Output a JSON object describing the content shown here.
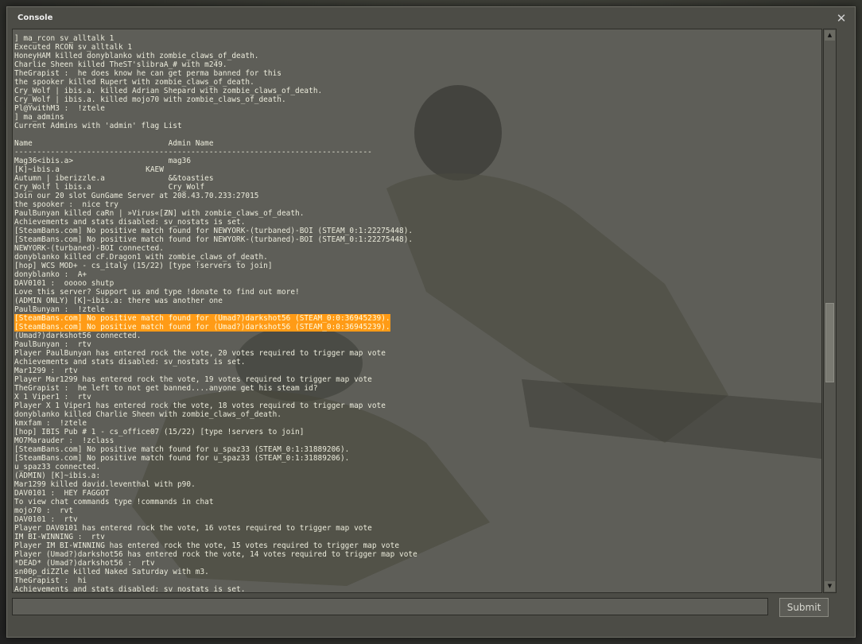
{
  "window": {
    "title": "Console",
    "close_label": "✕"
  },
  "console": {
    "lines": [
      {
        "text": "] ma_rcon sv_alltalk 1"
      },
      {
        "text": "Executed RCON sv_alltalk 1"
      },
      {
        "text": "HoneyHAM killed donyblanko with zombie_claws_of_death."
      },
      {
        "text": "Charlie Sheen killed TheST'slibraA_# with m249."
      },
      {
        "text": "TheGrapist :  he does know he can get perma banned for this"
      },
      {
        "text": "the spooker killed Rupert with zombie_claws_of_death."
      },
      {
        "text": "Cry_Wolf | ibis.a. killed Adrian Shepard with zombie_claws_of_death."
      },
      {
        "text": "Cry_Wolf | ibis.a. killed mojo70 with zombie_claws_of_death."
      },
      {
        "text": "Pl@YwithM3 :  !ztele"
      },
      {
        "text": "] ma_admins"
      },
      {
        "text": "Current Admins with 'admin' flag List"
      },
      {
        "text": ""
      },
      {
        "text": "Name                              Admin Name"
      },
      {
        "text": "-------------------------------------------------------------------------------"
      },
      {
        "text": "Mag36<ibis.a>                     mag36"
      },
      {
        "text": "[K]~ibis.a                   KAEW"
      },
      {
        "text": "Autumn | iberizzle.a              &&toasties"
      },
      {
        "text": "Cry_Wolf l ibis.a                 Cry_Wolf"
      },
      {
        "text": "Join our 20 slot GunGame Server at 208.43.70.233:27015"
      },
      {
        "text": "the spooker :  nice try"
      },
      {
        "text": "PaulBunyan killed caRn | »Virus«[ƵN] with zombie_claws_of_death."
      },
      {
        "text": "Achievements and stats disabled: sv_nostats is set."
      },
      {
        "text": "[SteamBans.com] No positive match found for NEWYORK-(turbaned)-BOI (STEAM_0:1:22275448)."
      },
      {
        "text": "[SteamBans.com] No positive match found for NEWYORK-(turbaned)-BOI (STEAM_0:1:22275448)."
      },
      {
        "text": "NEWYORK-(turbaned)-BOI connected."
      },
      {
        "text": "donyblanko killed cF.Dragon1 with zombie_claws_of_death."
      },
      {
        "text": "[hop] WCS MOD+ - cs_italy (15/22) [type !servers to join]"
      },
      {
        "text": "donyblanko :  A+"
      },
      {
        "text": "DAV0101 :  ooooo shutp"
      },
      {
        "text": "Love this server? Support us and type !donate to find out more!"
      },
      {
        "text": "(ADMIN ONLY) [K]~ibis.a: there was another one"
      },
      {
        "text": "PaulBunyan :  !ztele"
      },
      {
        "text": "[SteamBans.com] No positive match found for (Umad?)darkshot56 (STEAM_0:0:36945239).",
        "highlight": true
      },
      {
        "text": "[SteamBans.com] No positive match found for (Umad?)darkshot56 (STEAM_0:0:36945239).",
        "highlight": true
      },
      {
        "text": "(Umad?)darkshot56 connected."
      },
      {
        "text": "PaulBunyan :  rtv"
      },
      {
        "text": "Player PaulBunyan has entered rock the vote, 20 votes required to trigger map vote"
      },
      {
        "text": "Achievements and stats disabled: sv_nostats is set."
      },
      {
        "text": "Mar1299 :  rtv"
      },
      {
        "text": "Player Mar1299 has entered rock the vote, 19 votes required to trigger map vote"
      },
      {
        "text": "TheGrapist :  he left to not get banned....anyone get his steam id?"
      },
      {
        "text": "X 1 Viper1 :  rtv"
      },
      {
        "text": "Player X 1 Viper1 has entered rock the vote, 18 votes required to trigger map vote"
      },
      {
        "text": "donyblanko killed Charlie Sheen with zombie_claws_of_death."
      },
      {
        "text": "kmxfam :  !ztele"
      },
      {
        "text": "[hop] IBIS Pub # 1 - cs_office07 (15/22) [type !servers to join]"
      },
      {
        "text": "MO7Marauder :  !zclass"
      },
      {
        "text": "[SteamBans.com] No positive match found for u_spaz33 (STEAM_0:1:31889206)."
      },
      {
        "text": "[SteamBans.com] No positive match found for u_spaz33 (STEAM_0:1:31889206)."
      },
      {
        "text": "u_spaz33 connected."
      },
      {
        "text": "(ADMIN) [K]~ibis.a:"
      },
      {
        "text": "Mar1299 killed david.leventhal with p90."
      },
      {
        "text": "DAV0101 :  HEY FAGGOT"
      },
      {
        "text": "To view chat commands type !commands in chat"
      },
      {
        "text": "mojo70 :  rvt"
      },
      {
        "text": "DAV0101 :  rtv"
      },
      {
        "text": "Player DAV0101 has entered rock the vote, 16 votes required to trigger map vote"
      },
      {
        "text": "IM BI-WINNING :  rtv"
      },
      {
        "text": "Player IM BI-WINNING has entered rock the vote, 15 votes required to trigger map vote"
      },
      {
        "text": "Player (Umad?)darkshot56 has entered rock the vote, 14 votes required to trigger map vote"
      },
      {
        "text": "*DEAD* (Umad?)darkshot56 :  rtv"
      },
      {
        "text": "sn00p_diZZle killed Naked Saturday with m3."
      },
      {
        "text": "TheGrapist :  hi"
      },
      {
        "text": "Achievements and stats disabled: sv_nostats is set."
      }
    ]
  },
  "input": {
    "value": "",
    "placeholder": ""
  },
  "submit_label": "Submit",
  "scrollbar": {
    "up_icon": "▲",
    "down_icon": "▼"
  },
  "colors": {
    "highlight": "#ff9b16",
    "text": "#ececdc",
    "panel": "#5e5e58"
  }
}
